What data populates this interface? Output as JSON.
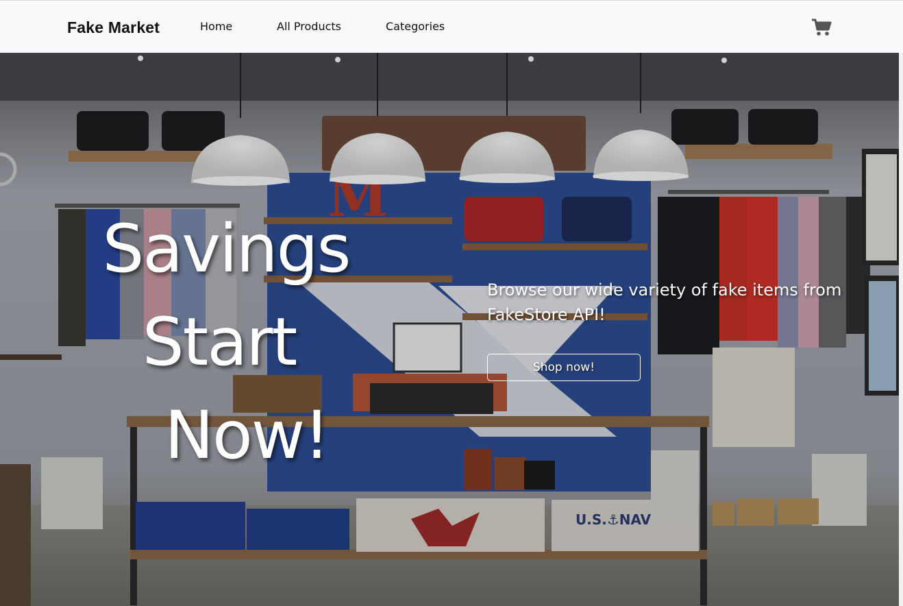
{
  "navbar": {
    "brand": "Fake Market",
    "links": [
      "Home",
      "All Products",
      "Categories"
    ],
    "cart_icon": "shopping-cart-icon",
    "background": "#f8f9fa"
  },
  "hero": {
    "title_lines": [
      "Savings",
      "Start",
      "Now!"
    ],
    "subtitle": "Browse our wide variety of fake items from FakeStore API!",
    "cta_label": "Shop now!",
    "background_image": "clothing store interior photo"
  }
}
